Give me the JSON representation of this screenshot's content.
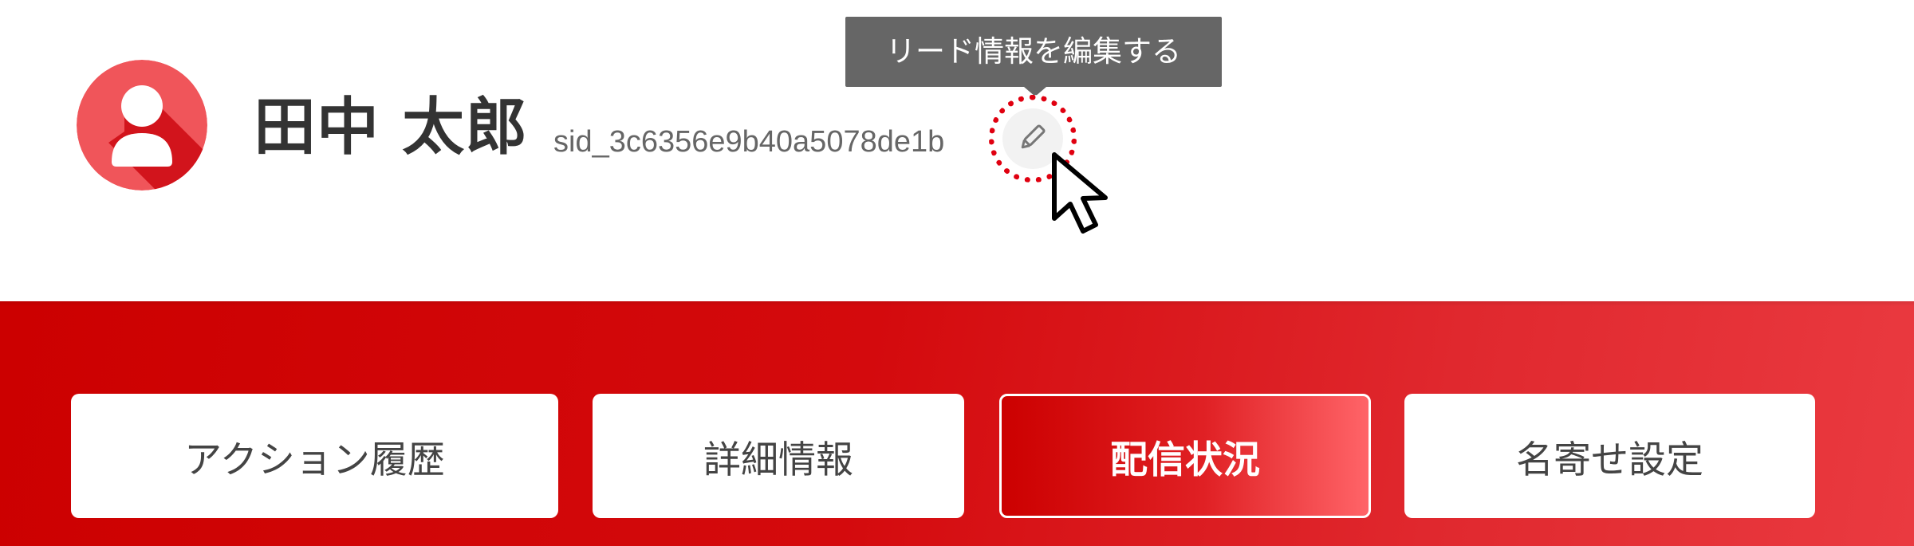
{
  "user": {
    "name": "田中 太郎",
    "session_id": "sid_3c6356e9b40a5078de1b"
  },
  "tooltip": {
    "text": "リード情報を編集する"
  },
  "tabs": [
    {
      "label": "アクション履歴",
      "active": false
    },
    {
      "label": "詳細情報",
      "active": false
    },
    {
      "label": "配信状況",
      "active": true
    },
    {
      "label": "名寄せ設定",
      "active": false
    }
  ],
  "icons": {
    "avatar": "user-avatar-icon",
    "edit": "pencil-icon",
    "cursor": "mouse-pointer-icon"
  },
  "colors": {
    "brand_red": "#cc0000",
    "avatar_red": "#f0555a",
    "highlight_dotted": "#e00010",
    "tooltip_bg": "#666666"
  }
}
